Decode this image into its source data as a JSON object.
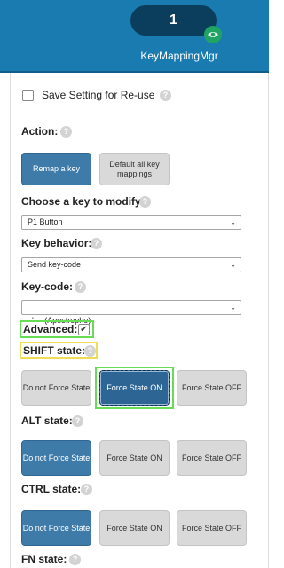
{
  "header": {
    "count": "1",
    "title": "KeyMappingMgr",
    "icon": "eye-icon",
    "accent": "#1a7bb0"
  },
  "save_setting": {
    "label": "Save Setting for Re-use",
    "checked": false
  },
  "action": {
    "label": "Action:",
    "remap_label": "Remap a key",
    "default_label": "Default all key mappings"
  },
  "choose_key": {
    "label": "Choose a key to modify:",
    "value": "P1 Button"
  },
  "key_behavior": {
    "label": "Key behavior:",
    "value": "Send key-code"
  },
  "key_code": {
    "label": "Key-code:",
    "value": "'     (Apostrophe)"
  },
  "advanced": {
    "label": "Advanced:",
    "checked": true,
    "check_glyph": "✔"
  },
  "shift": {
    "label": "SHIFT state:",
    "options": [
      "Do not Force State",
      "Force State ON",
      "Force State OFF"
    ],
    "selected": "Force State ON"
  },
  "alt": {
    "label": "ALT state:",
    "options": [
      "Do not Force State",
      "Force State ON",
      "Force State OFF"
    ],
    "selected": "Do not Force State"
  },
  "ctrl": {
    "label": "CTRL state:",
    "options": [
      "Do not Force State",
      "Force State ON",
      "Force State OFF"
    ],
    "selected": "Do not Force State"
  },
  "fn": {
    "label": "FN state:"
  },
  "help_glyph": "?",
  "chevron_glyph": "⌄"
}
